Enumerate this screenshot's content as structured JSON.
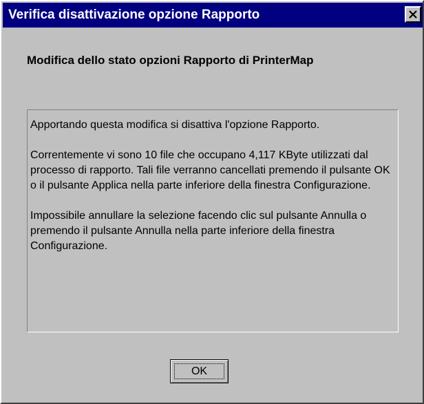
{
  "window": {
    "title": "Verifica disattivazione opzione Rapporto",
    "close_icon": "close-icon"
  },
  "heading": "Modifica dello stato opzioni Rapporto di PrinterMap",
  "message": {
    "paragraph1": "Apportando questa modifica si disattiva l'opzione Rapporto.",
    "paragraph2": "Correntemente vi sono 10 file che occupano 4,117 KByte utilizzati dal processo di rapporto. Tali file verranno cancellati premendo il pulsante OK o il pulsante Applica nella parte inferiore della finestra Configurazione.",
    "paragraph3": "Impossibile annullare la selezione facendo clic sul pulsante Annulla o premendo il pulsante Annulla nella parte inferiore della finestra Configurazione."
  },
  "buttons": {
    "ok_label": "OK"
  },
  "colors": {
    "titlebar": "#000080",
    "face": "#c0c0c0"
  }
}
